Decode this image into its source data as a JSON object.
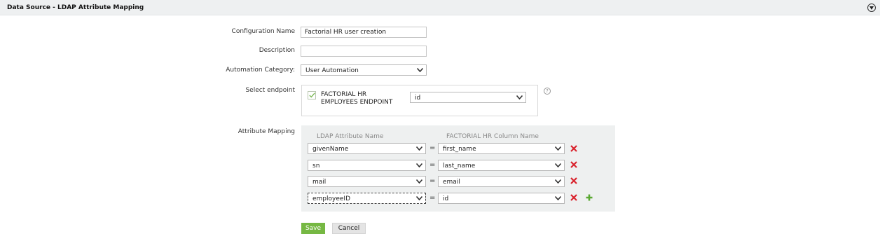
{
  "header": {
    "title": "Data Source - LDAP Attribute Mapping",
    "collapse_icon": "chevron-circle-down-icon"
  },
  "form": {
    "config_name_label": "Configuration Name",
    "config_name_value": "Factorial HR user creation",
    "description_label": "Description",
    "description_value": "",
    "automation_label": "Automation Category:",
    "automation_value": "User Automation",
    "endpoint_label": "Select endpoint",
    "endpoint_checked": true,
    "endpoint_name": "FACTORIAL HR EMPLOYEES ENDPOINT",
    "endpoint_key": "id",
    "mapping_label": "Attribute Mapping"
  },
  "mapping": {
    "ldap_header": "LDAP Attribute Name",
    "column_header": "FACTORIAL HR Column Name",
    "equals": "=",
    "rows": [
      {
        "ldap": "givenName",
        "column": "first_name"
      },
      {
        "ldap": "sn",
        "column": "last_name"
      },
      {
        "ldap": "mail",
        "column": "email"
      },
      {
        "ldap": "employeeID",
        "column": "id"
      }
    ]
  },
  "buttons": {
    "save": "Save",
    "cancel": "Cancel"
  },
  "colors": {
    "delete": "#d9232d",
    "add": "#5aa832",
    "save": "#76b843"
  }
}
